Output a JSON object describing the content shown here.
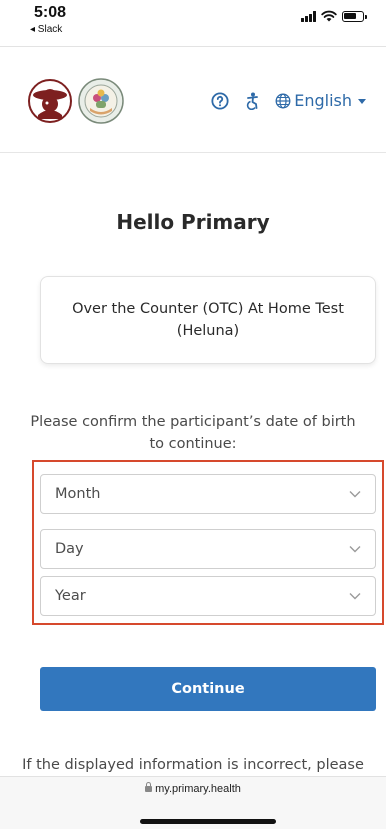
{
  "status_bar": {
    "time": "5:08",
    "back_label": "◂ Slack"
  },
  "header": {
    "language_label": "English",
    "icons": {
      "help": "help-circle-icon",
      "accessibility": "accessibility-icon",
      "globe": "globe-icon",
      "caret": "caret-down-icon"
    }
  },
  "main": {
    "title": "Hello Primary",
    "test_card_text": "Over the Counter (OTC) At Home Test (Heluna)",
    "instruction": "Please confirm the participant’s date of birth to continue:",
    "dob": {
      "month_placeholder": "Month",
      "day_placeholder": "Day",
      "year_placeholder": "Year"
    },
    "continue_label": "Continue",
    "footnote": "If the displayed information is incorrect, please"
  },
  "browser": {
    "url": "my.primary.health"
  },
  "colors": {
    "accent": "#3277be",
    "link": "#2e6aa8",
    "highlight": "#d6492d"
  }
}
